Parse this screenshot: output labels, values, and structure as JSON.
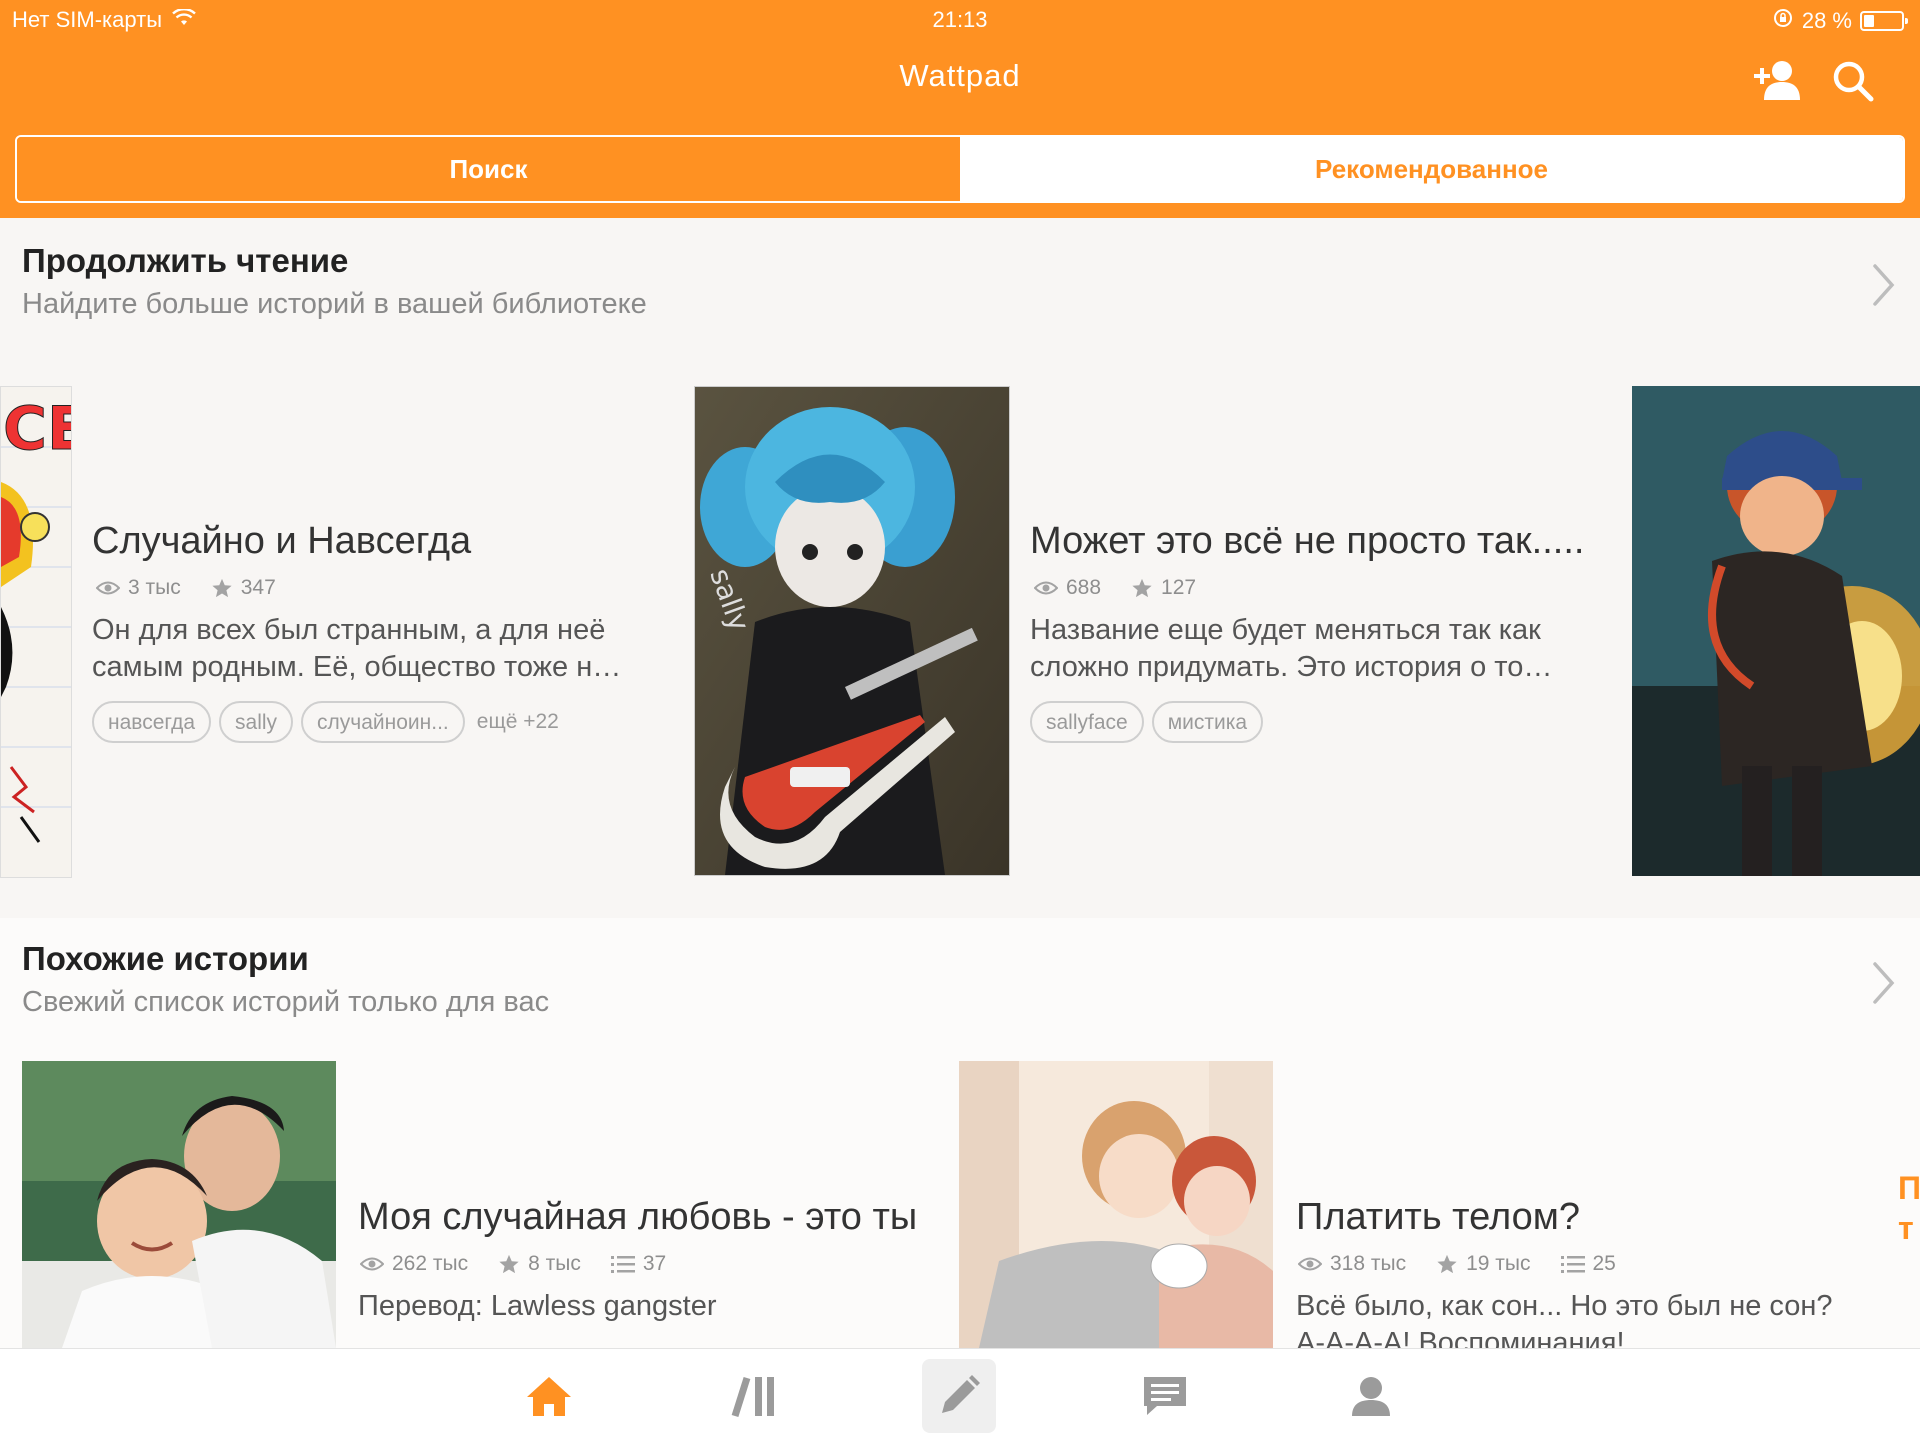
{
  "status_bar": {
    "carrier": "Нет SIM-карты",
    "time": "21:13",
    "battery": "28 %"
  },
  "header": {
    "title": "Wattpad",
    "icons": [
      "add-user-icon",
      "search-icon"
    ]
  },
  "segments": [
    {
      "label": "Поиск",
      "active": true
    },
    {
      "label": "Рекомендованное",
      "active": false
    }
  ],
  "continue_reading": {
    "title": "Продолжить чтение",
    "subtitle": "Найдите больше историй в вашей библиотеке",
    "stories": [
      {
        "title": "Случайно и Навсегда",
        "views": "3 тыс",
        "votes": "347",
        "description_line1": "Он для всех был странным, а для неё",
        "description_line2": "самым родным. Её, общество тоже н…",
        "tags": [
          "навсегда",
          "sally",
          "случайноин..."
        ],
        "more_tags": "ещё +22"
      },
      {
        "title": "Может это всё не просто так.....",
        "views": "688",
        "votes": "127",
        "description_line1": "Название еще будет меняться так как",
        "description_line2": "сложно придумать. Это история о то…",
        "tags": [
          "sallyface",
          "мистика"
        ]
      }
    ]
  },
  "similar": {
    "title": "Похожие истории",
    "subtitle": "Свежий список историй только для вас",
    "stories": [
      {
        "title": "Моя случайная любовь - это ты",
        "views": "262 тыс",
        "votes": "8 тыс",
        "parts": "37",
        "description_line1": "Перевод: Lawless gangster"
      },
      {
        "title": "Платить телом?",
        "views": "318 тыс",
        "votes": "19 тыс",
        "parts": "25",
        "description_line1": "Всё было, как сон...  Но это был не сон?",
        "description_line2": "А-А-А-А! Воспоминания!"
      }
    ],
    "peek_text_line1": "П",
    "peek_text_line2": "т"
  },
  "tab_bar": {
    "tabs": [
      "home-icon",
      "library-icon",
      "write-icon",
      "messages-icon",
      "profile-icon"
    ],
    "active": "home-icon"
  },
  "colors": {
    "brand": "#ff9122",
    "inactive_icon": "#9b9b9b"
  }
}
